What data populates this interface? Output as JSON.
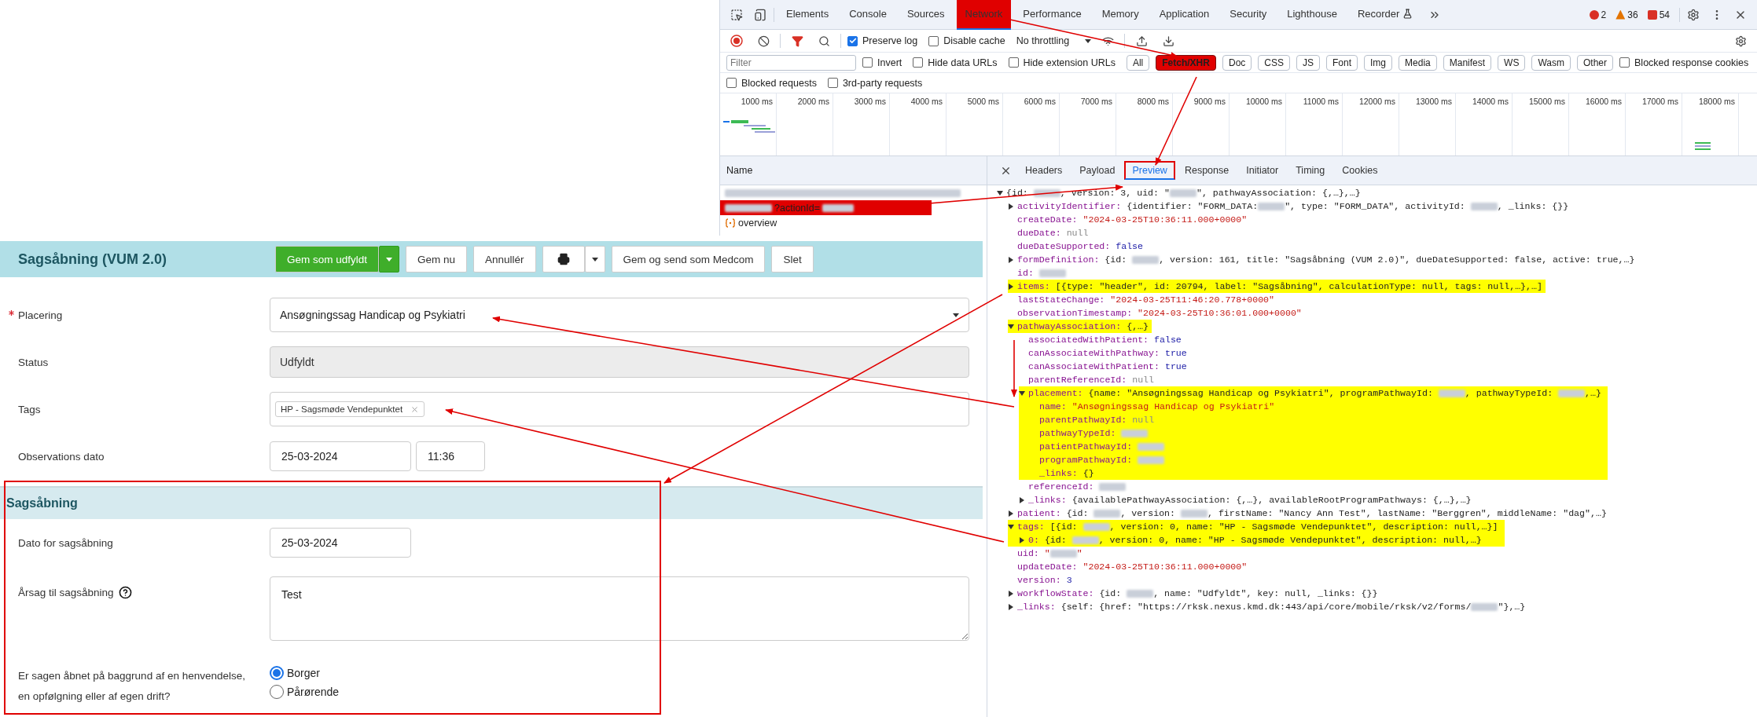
{
  "devtools": {
    "tabs": [
      {
        "label": "Elements",
        "selected": false,
        "annotated": false,
        "experimental": false
      },
      {
        "label": "Console",
        "selected": false,
        "annotated": false,
        "experimental": false
      },
      {
        "label": "Sources",
        "selected": false,
        "annotated": false,
        "experimental": false
      },
      {
        "label": "Network",
        "selected": true,
        "annotated": true,
        "experimental": false
      },
      {
        "label": "Performance",
        "selected": false,
        "annotated": false,
        "experimental": false
      },
      {
        "label": "Memory",
        "selected": false,
        "annotated": false,
        "experimental": false
      },
      {
        "label": "Application",
        "selected": false,
        "annotated": false,
        "experimental": false
      },
      {
        "label": "Security",
        "selected": false,
        "annotated": false,
        "experimental": false
      },
      {
        "label": "Lighthouse",
        "selected": false,
        "annotated": false,
        "experimental": false
      },
      {
        "label": "Recorder",
        "selected": false,
        "annotated": false,
        "experimental": true
      }
    ],
    "counts": {
      "errors": "2",
      "warnings": "36",
      "issues": "54"
    },
    "toolbar": {
      "checkboxes": [
        {
          "label": "Preserve log",
          "checked": true
        },
        {
          "label": "Disable cache",
          "checked": false
        }
      ],
      "throttling": "No throttling"
    },
    "filter": {
      "placeholder": "Filter",
      "checkboxes": [
        {
          "label": "Invert",
          "checked": false
        },
        {
          "label": "Hide data URLs",
          "checked": false
        },
        {
          "label": "Hide extension URLs",
          "checked": false
        }
      ],
      "chips": [
        {
          "label": "All",
          "selected": false,
          "annotated": false
        },
        {
          "label": "Fetch/XHR",
          "selected": true,
          "annotated": true
        },
        {
          "label": "Doc",
          "selected": false,
          "annotated": false
        },
        {
          "label": "CSS",
          "selected": false,
          "annotated": false
        },
        {
          "label": "JS",
          "selected": false,
          "annotated": false
        },
        {
          "label": "Font",
          "selected": false,
          "annotated": false
        },
        {
          "label": "Img",
          "selected": false,
          "annotated": false
        },
        {
          "label": "Media",
          "selected": false,
          "annotated": false
        },
        {
          "label": "Manifest",
          "selected": false,
          "annotated": false
        },
        {
          "label": "WS",
          "selected": false,
          "annotated": false
        },
        {
          "label": "Wasm",
          "selected": false,
          "annotated": false
        },
        {
          "label": "Other",
          "selected": false,
          "annotated": false
        }
      ],
      "trailing_checkboxes": [
        {
          "label": "Blocked response cookies",
          "checked": false
        }
      ]
    },
    "options": {
      "checkboxes": [
        {
          "label": "Blocked requests",
          "checked": false
        },
        {
          "label": "3rd-party requests",
          "checked": false
        }
      ]
    },
    "timeline": {
      "ticks": [
        "1000 ms",
        "2000 ms",
        "3000 ms",
        "4000 ms",
        "5000 ms",
        "6000 ms",
        "7000 ms",
        "8000 ms",
        "9000 ms",
        "10000 ms",
        "11000 ms",
        "12000 ms",
        "13000 ms",
        "14000 ms",
        "15000 ms",
        "16000 ms",
        "17000 ms",
        "18000 ms"
      ]
    },
    "requests": {
      "header": "Name",
      "rows": [
        {
          "kind": "redacted",
          "annotated": false
        },
        {
          "kind": "query",
          "text": "?actionId=",
          "annotated": true
        },
        {
          "kind": "document",
          "text": "overview",
          "annotated": false
        }
      ]
    },
    "detail": {
      "tabs": [
        {
          "label": "Headers",
          "selected": false,
          "annotated": false
        },
        {
          "label": "Payload",
          "selected": false,
          "annotated": false
        },
        {
          "label": "Preview",
          "selected": true,
          "annotated": true
        },
        {
          "label": "Response",
          "selected": false,
          "annotated": false
        },
        {
          "label": "Initiator",
          "selected": false,
          "annotated": false
        },
        {
          "label": "Timing",
          "selected": false,
          "annotated": false
        },
        {
          "label": "Cookies",
          "selected": false,
          "annotated": false
        }
      ],
      "tree": [
        {
          "expanded": true,
          "highlighted": false,
          "value": [
            {
              "kind": "plain",
              "text": "{id: "
            },
            {
              "kind": "redacted"
            },
            {
              "kind": "plain",
              "text": ", version: 3, uid: \""
            },
            {
              "kind": "redacted"
            },
            {
              "kind": "plain",
              "text": "\", pathwayAssociation: {,…},…}"
            }
          ],
          "children": [
            {
              "key": "activityIdentifier:",
              "expanded": false,
              "highlighted": false,
              "value": [
                {
                  "kind": "plain",
                  "text": "{identifier: \"FORM_DATA:"
                },
                {
                  "kind": "redacted"
                },
                {
                  "kind": "plain",
                  "text": "\", type: \"FORM_DATA\", activityId: "
                },
                {
                  "kind": "redacted"
                },
                {
                  "kind": "plain",
                  "text": ", _links: {}}"
                }
              ]
            },
            {
              "key": "createDate:",
              "highlighted": false,
              "value": [
                {
                  "kind": "string",
                  "text": "\"2024-03-25T10:36:11.000+0000\""
                }
              ]
            },
            {
              "key": "dueDate:",
              "highlighted": false,
              "value": [
                {
                  "kind": "null",
                  "text": "null"
                }
              ]
            },
            {
              "key": "dueDateSupported:",
              "highlighted": false,
              "value": [
                {
                  "kind": "keyword",
                  "text": "false"
                }
              ]
            },
            {
              "key": "formDefinition:",
              "expanded": false,
              "highlighted": false,
              "value": [
                {
                  "kind": "plain",
                  "text": "{id: "
                },
                {
                  "kind": "redacted"
                },
                {
                  "kind": "plain",
                  "text": ", version: 161, title: \"Sagsåbning (VUM 2.0)\", dueDateSupported: false, active: true,…}"
                }
              ]
            },
            {
              "key": "id:",
              "highlighted": false,
              "value": [
                {
                  "kind": "redacted"
                }
              ]
            },
            {
              "key": "items:",
              "expanded": false,
              "highlighted": true,
              "value": [
                {
                  "kind": "plain",
                  "text": "[{type: \"header\", id: 20794, label: \"Sagsåbning\", calculationType: null, tags: null,…},…]"
                }
              ]
            },
            {
              "key": "lastStateChange:",
              "highlighted": false,
              "value": [
                {
                  "kind": "string",
                  "text": "\"2024-03-25T11:46:20.778+0000\""
                }
              ]
            },
            {
              "key": "observationTimestamp:",
              "highlighted": false,
              "value": [
                {
                  "kind": "string",
                  "text": "\"2024-03-25T10:36:01.000+0000\""
                }
              ]
            },
            {
              "key": "pathwayAssociation:",
              "expanded": true,
              "highlighted": true,
              "value": [
                {
                  "kind": "plain",
                  "text": "{,…}"
                }
              ],
              "children": [
                {
                  "key": "associatedWithPatient:",
                  "highlighted": false,
                  "value": [
                    {
                      "kind": "keyword",
                      "text": "false"
                    }
                  ]
                },
                {
                  "key": "canAssociateWithPathway:",
                  "highlighted": false,
                  "value": [
                    {
                      "kind": "keyword",
                      "text": "true"
                    }
                  ]
                },
                {
                  "key": "canAssociateWithPatient:",
                  "highlighted": false,
                  "value": [
                    {
                      "kind": "keyword",
                      "text": "true"
                    }
                  ]
                },
                {
                  "key": "parentReferenceId:",
                  "highlighted": false,
                  "value": [
                    {
                      "kind": "null",
                      "text": "null"
                    }
                  ]
                },
                {
                  "key": "placement:",
                  "expanded": true,
                  "highlighted": true,
                  "value": [
                    {
                      "kind": "plain",
                      "text": "{name: \"Ansøgningssag Handicap og Psykiatri\", programPathwayId: "
                    },
                    {
                      "kind": "redacted"
                    },
                    {
                      "kind": "plain",
                      "text": ", pathwayTypeId: "
                    },
                    {
                      "kind": "redacted"
                    },
                    {
                      "kind": "plain",
                      "text": ",…}"
                    }
                  ],
                  "children": [
                    {
                      "key": "name:",
                      "highlighted": true,
                      "value": [
                        {
                          "kind": "string",
                          "text": "\"Ansøgningssag Handicap og Psykiatri\""
                        }
                      ]
                    },
                    {
                      "key": "parentPathwayId:",
                      "highlighted": true,
                      "value": [
                        {
                          "kind": "null",
                          "text": "null"
                        }
                      ]
                    },
                    {
                      "key": "pathwayTypeId:",
                      "highlighted": true,
                      "value": [
                        {
                          "kind": "redacted"
                        }
                      ]
                    },
                    {
                      "key": "patientPathwayId:",
                      "highlighted": true,
                      "value": [
                        {
                          "kind": "redacted"
                        }
                      ]
                    },
                    {
                      "key": "programPathwayId:",
                      "highlighted": true,
                      "value": [
                        {
                          "kind": "redacted"
                        }
                      ]
                    },
                    {
                      "key": "_links:",
                      "highlighted": true,
                      "value": [
                        {
                          "kind": "plain",
                          "text": "{}"
                        }
                      ]
                    }
                  ]
                },
                {
                  "key": "referenceId:",
                  "highlighted": false,
                  "value": [
                    {
                      "kind": "redacted"
                    }
                  ]
                },
                {
                  "key": "_links:",
                  "expanded": false,
                  "highlighted": false,
                  "value": [
                    {
                      "kind": "plain",
                      "text": "{availablePathwayAssociation: {,…}, availableRootProgramPathways: {,…},…}"
                    }
                  ]
                }
              ]
            },
            {
              "key": "patient:",
              "expanded": false,
              "highlighted": false,
              "value": [
                {
                  "kind": "plain",
                  "text": "{id: "
                },
                {
                  "kind": "redacted"
                },
                {
                  "kind": "plain",
                  "text": ", version: "
                },
                {
                  "kind": "redacted"
                },
                {
                  "kind": "plain",
                  "text": ", firstName: \"Nancy Ann Test\", lastName: \"Berggren\", middleName: \"dag\",…}"
                }
              ]
            },
            {
              "key": "tags:",
              "expanded": true,
              "highlighted": true,
              "value": [
                {
                  "kind": "plain",
                  "text": "[{id: "
                },
                {
                  "kind": "redacted"
                },
                {
                  "kind": "plain",
                  "text": ", version: 0, name: \"HP - Sagsmøde Vendepunktet\", description: null,…}]"
                }
              ],
              "children": [
                {
                  "key": "0:",
                  "expanded": false,
                  "highlighted": true,
                  "value": [
                    {
                      "kind": "plain",
                      "text": "{id: "
                    },
                    {
                      "kind": "redacted"
                    },
                    {
                      "kind": "plain",
                      "text": ", version: 0, name: \"HP - Sagsmøde Vendepunktet\", description: null,…}"
                    }
                  ]
                }
              ]
            },
            {
              "key": "uid:",
              "highlighted": false,
              "value": [
                {
                  "kind": "string",
                  "text": "\""
                },
                {
                  "kind": "redacted"
                },
                {
                  "kind": "string",
                  "text": "\""
                }
              ]
            },
            {
              "key": "updateDate:",
              "highlighted": false,
              "value": [
                {
                  "kind": "string",
                  "text": "\"2024-03-25T10:36:11.000+0000\""
                }
              ]
            },
            {
              "key": "version:",
              "highlighted": false,
              "value": [
                {
                  "kind": "keyword",
                  "text": "3"
                }
              ]
            },
            {
              "key": "workflowState:",
              "expanded": false,
              "highlighted": false,
              "value": [
                {
                  "kind": "plain",
                  "text": "{id: "
                },
                {
                  "kind": "redacted"
                },
                {
                  "kind": "plain",
                  "text": ", name: \"Udfyldt\", key: null, _links: {}}"
                }
              ]
            },
            {
              "key": "_links:",
              "expanded": false,
              "highlighted": false,
              "value": [
                {
                  "kind": "plain",
                  "text": "{self: {href: \"https://rksk.nexus.kmd.dk:443/api/core/mobile/rksk/v2/forms/"
                },
                {
                  "kind": "redacted"
                },
                {
                  "kind": "plain",
                  "text": "\"},…}"
                }
              ]
            }
          ]
        }
      ]
    }
  },
  "form": {
    "title": "Sagsåbning (VUM 2.0)",
    "buttons": [
      {
        "kind": "primary-split",
        "label": "Gem som udfyldt"
      },
      {
        "kind": "default",
        "label": "Gem nu"
      },
      {
        "kind": "default",
        "label": "Annullér"
      },
      {
        "kind": "print-split"
      },
      {
        "kind": "default",
        "label": "Gem og send som Medcom"
      },
      {
        "kind": "default",
        "label": "Slet"
      }
    ],
    "fields": [
      {
        "kind": "select",
        "label": "Placering",
        "required": true,
        "value": "Ansøgningssag Handicap og Psykiatri"
      },
      {
        "kind": "readonly",
        "label": "Status",
        "required": false,
        "value": "Udfyldt"
      },
      {
        "kind": "tags",
        "label": "Tags",
        "required": false,
        "tags": [
          "HP - Sagsmøde Vendepunktet"
        ]
      },
      {
        "kind": "datetime",
        "label": "Observations dato",
        "required": false,
        "date": "25-03-2024",
        "time": "11:36"
      }
    ],
    "section": {
      "title": "Sagsåbning",
      "annotated": true,
      "fields": [
        {
          "kind": "date",
          "label": "Dato for sagsåbning",
          "help": false,
          "value": "25-03-2024"
        },
        {
          "kind": "textarea",
          "label": "Årsag til sagsåbning",
          "help": true,
          "value": "Test"
        },
        {
          "kind": "radio",
          "label": "Er sagen åbnet på baggrund af en henvendelse, en opfølgning eller af egen drift?",
          "help": false,
          "options": [
            {
              "label": "Borger",
              "selected": true
            },
            {
              "label": "Pårørende",
              "selected": false
            }
          ]
        }
      ]
    }
  }
}
